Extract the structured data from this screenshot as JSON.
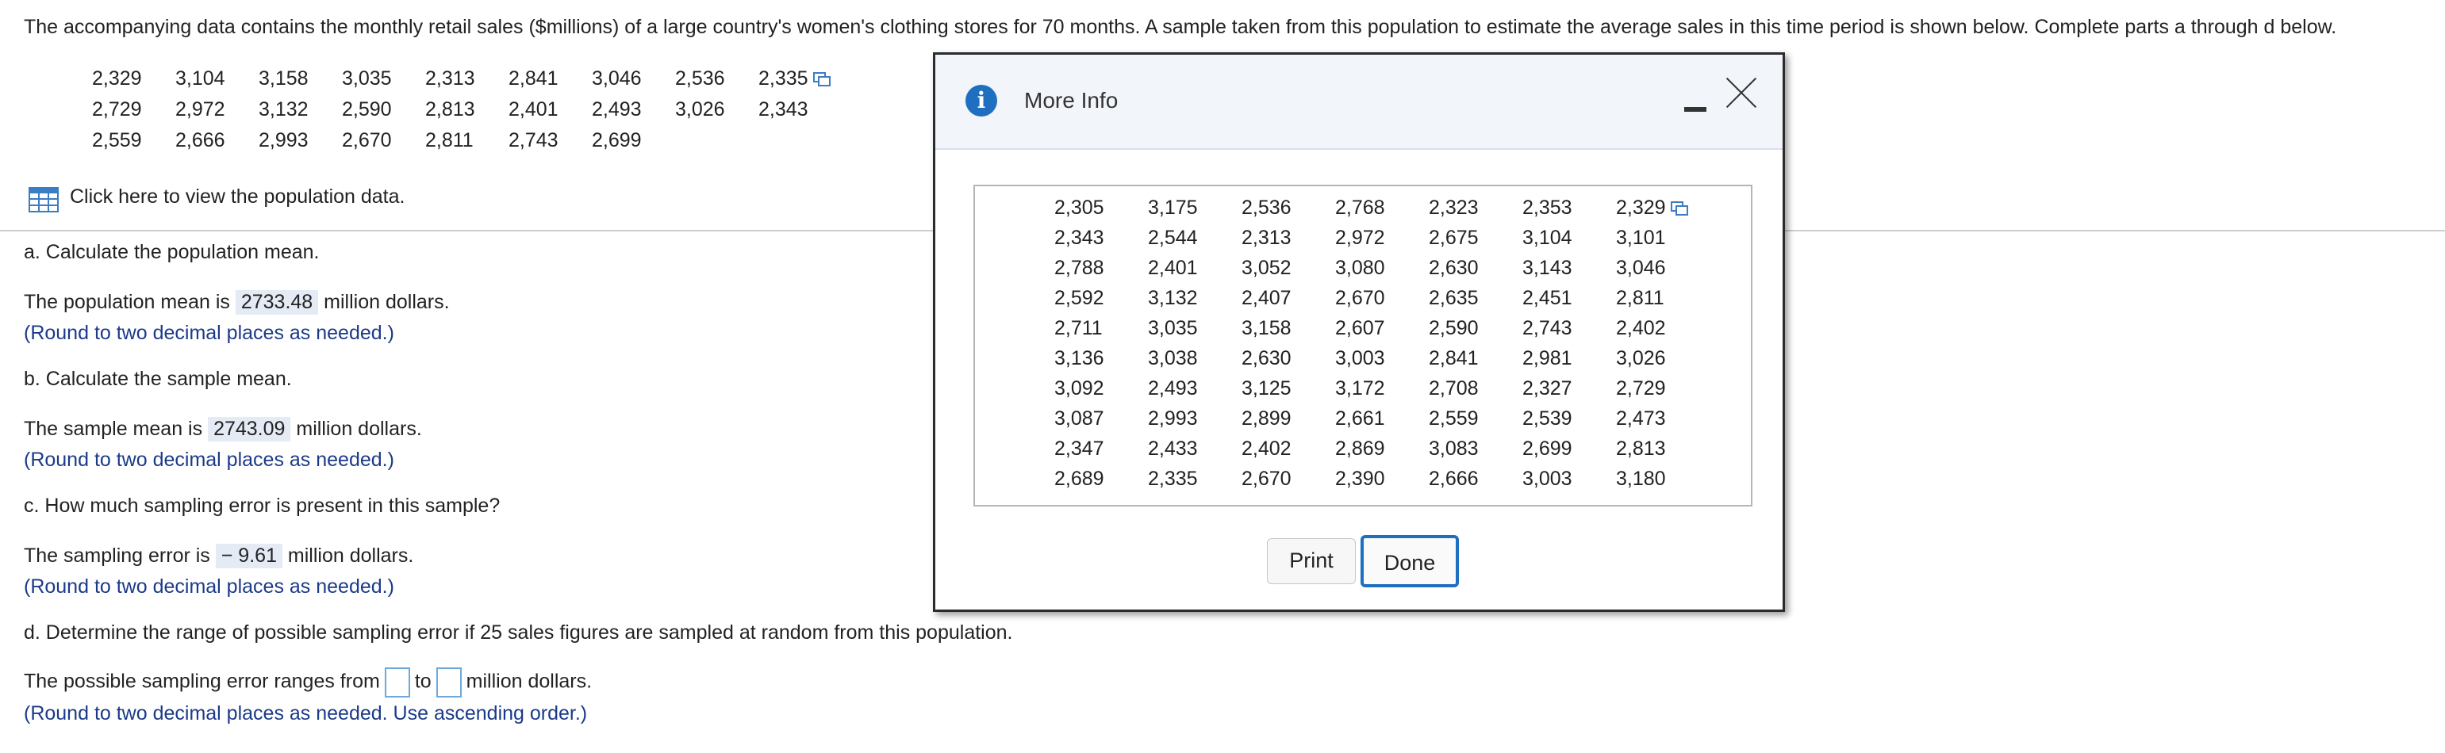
{
  "question": {
    "intro": "The accompanying data contains the monthly retail sales ($millions) of a large country's women's clothing stores for 70 months. A sample taken from this population to estimate the average sales in this time period is shown below. Complete parts a through d below."
  },
  "sample_rows": [
    [
      "2,329",
      "3,104",
      "3,158",
      "3,035",
      "2,313",
      "2,841",
      "3,046",
      "2,536",
      "2,335"
    ],
    [
      "2,729",
      "2,972",
      "3,132",
      "2,590",
      "2,813",
      "2,401",
      "2,493",
      "3,026",
      "2,343"
    ],
    [
      "2,559",
      "2,666",
      "2,993",
      "2,670",
      "2,811",
      "2,743",
      "2,699"
    ]
  ],
  "population_link": "Click here to view the population data.",
  "part_a": {
    "prompt": "a. Calculate the population mean.",
    "prefix": "The population mean is",
    "answer": "2733.48",
    "suffix": "million dollars.",
    "hint": "(Round to two decimal places as needed.)"
  },
  "part_b": {
    "prompt": "b. Calculate the sample mean.",
    "prefix": "The sample mean is",
    "answer": "2743.09",
    "suffix": "million dollars.",
    "hint": "(Round to two decimal places as needed.)"
  },
  "part_c": {
    "prompt": "c. How much sampling error is present in this sample?",
    "prefix": "The sampling error is",
    "answer": "− 9.61",
    "suffix": "million dollars.",
    "hint": "(Round to two decimal places as needed.)"
  },
  "part_d": {
    "prompt": "d. Determine the range of possible sampling error if 25 sales figures are sampled at random from this population.",
    "prefix": "The possible sampling error ranges from",
    "middle": "to",
    "suffix": "million dollars.",
    "hint": "(Round to two decimal places as needed. Use ascending order.)"
  },
  "modal": {
    "title": "More Info",
    "print_label": "Print",
    "done_label": "Done",
    "rows": [
      [
        "2,305",
        "3,175",
        "2,536",
        "2,768",
        "2,323",
        "2,353",
        "2,329"
      ],
      [
        "2,343",
        "2,544",
        "2,313",
        "2,972",
        "2,675",
        "3,104",
        "3,101"
      ],
      [
        "2,788",
        "2,401",
        "3,052",
        "3,080",
        "2,630",
        "3,143",
        "3,046"
      ],
      [
        "2,592",
        "3,132",
        "2,407",
        "2,670",
        "2,635",
        "2,451",
        "2,811"
      ],
      [
        "2,711",
        "3,035",
        "3,158",
        "2,607",
        "2,590",
        "2,743",
        "2,402"
      ],
      [
        "3,136",
        "3,038",
        "2,630",
        "3,003",
        "2,841",
        "2,981",
        "3,026"
      ],
      [
        "3,092",
        "2,493",
        "3,125",
        "3,172",
        "2,708",
        "2,327",
        "2,729"
      ],
      [
        "3,087",
        "2,993",
        "2,899",
        "2,661",
        "2,559",
        "2,539",
        "2,473"
      ],
      [
        "2,347",
        "2,433",
        "2,402",
        "2,869",
        "3,083",
        "2,699",
        "2,813"
      ],
      [
        "2,689",
        "2,335",
        "2,670",
        "2,390",
        "2,666",
        "3,003",
        "3,180"
      ]
    ]
  },
  "icons": {
    "info": "info-icon",
    "grid": "grid-icon",
    "copy": "copy-icon",
    "minimize": "minimize-icon",
    "close": "close-icon"
  },
  "colors": {
    "link_blue": "#1b3a8a",
    "accent": "#1f6fc1",
    "answer_bg": "#e4ebf5"
  }
}
